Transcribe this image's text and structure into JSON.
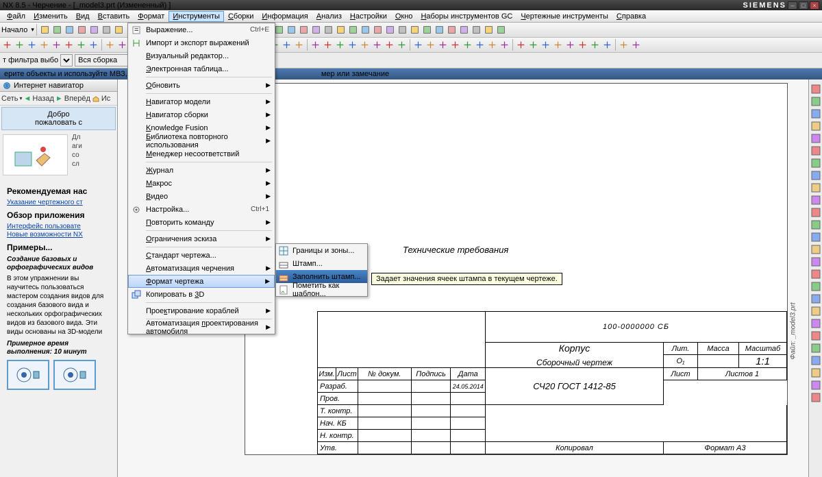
{
  "title": "NX 8.5 - Черчение - [_model3.prt (Измененный) ]",
  "brand": "SIEMENS",
  "menubar": [
    "Файл",
    "Изменить",
    "Вид",
    "Вставить",
    "Формат",
    "Инструменты",
    "Сборки",
    "Информация",
    "Анализ",
    "Настройки",
    "Окно",
    "Наборы инструментов GC",
    "Чертежные инструменты",
    "Справка"
  ],
  "toolbar1_label": "Начало",
  "filter_label": "т фильтра выбо",
  "filter_combo": "Вся сборка",
  "selbar_text": "ерите объекты и используйте МВЗ, или дво",
  "selbar_hint": "мер или замечание",
  "sidebar": {
    "title": "Интернет навигатор",
    "nav": [
      "Сеть",
      "Назад",
      "Вперёд",
      "Ис"
    ],
    "welcome1": "Добро",
    "welcome2": "пожаловать с",
    "side_txt": "Дл\nаги\nсо\nсл",
    "h1": "Рекомендуемая нас",
    "link1": "Указание чертежного ст",
    "h2": "Обзор приложения",
    "link2": "Интерфейс пользовате",
    "link3": "Новые возможности NX",
    "h3": "Примеры...",
    "em1": "Создание базовых и орфографических видов",
    "p1": "В этом упражнении вы научитесь пользоваться мастером создания видов для создания базового вида и нескольких орфографических видов из базового вида. Эти виды основаны на 3D-модели",
    "em2": "Примерное время выполнения: 10 минут"
  },
  "menu": {
    "items": [
      {
        "t": "Выражение...",
        "sc": "Ctrl+E",
        "ico": "expr"
      },
      {
        "t": "Импорт и экспорт выражений",
        "ico": "impexp"
      },
      {
        "t": "Визуальный редактор...",
        "u": "В"
      },
      {
        "t": "Электронная таблица...",
        "u": "Э"
      },
      {
        "sep": 1
      },
      {
        "t": "Обновить",
        "arr": 1,
        "u": "О"
      },
      {
        "sep": 1
      },
      {
        "t": "Навигатор модели",
        "arr": 1,
        "u": "Н"
      },
      {
        "t": "Навигатор сборки",
        "arr": 1,
        "u": "Н"
      },
      {
        "t": "Knowledge Fusion",
        "arr": 1,
        "u": "K"
      },
      {
        "t": "Библиотека повторного использования",
        "arr": 1,
        "u": "Б"
      },
      {
        "t": "Менеджер несоответствий",
        "u": "М"
      },
      {
        "sep": 1
      },
      {
        "t": "Журнал",
        "arr": 1,
        "u": "Ж"
      },
      {
        "t": "Макрос",
        "arr": 1,
        "u": "М"
      },
      {
        "t": "Видео",
        "arr": 1,
        "u": "В"
      },
      {
        "t": "Настройка...",
        "sc": "Ctrl+1",
        "ico": "gear"
      },
      {
        "t": "Повторить команду",
        "arr": 1,
        "u": "П"
      },
      {
        "sep": 1
      },
      {
        "t": "Ограничения эскиза",
        "arr": 1,
        "u": "О"
      },
      {
        "sep": 1
      },
      {
        "t": "Стандарт чертежа...",
        "u": "С"
      },
      {
        "t": "Автоматизация черчения",
        "arr": 1,
        "u": "А"
      },
      {
        "t": "Формат чертежа",
        "arr": 1,
        "hl": 1,
        "u": "Ф"
      },
      {
        "t": "Копировать в 3D",
        "ico": "copy3d",
        "u": "3"
      },
      {
        "sep": 1
      },
      {
        "t": "Проектирование кораблей",
        "arr": 1,
        "u": "к"
      },
      {
        "sep": 1
      },
      {
        "t": "Автоматизация проектирования автомобиля",
        "arr": 1,
        "u": "п"
      }
    ]
  },
  "submenu": {
    "items": [
      {
        "t": "Границы и зоны...",
        "ico": "bz"
      },
      {
        "t": "Штамп...",
        "ico": "st"
      },
      {
        "t": "Заполнить штамп...",
        "ico": "fill",
        "hl": 1
      },
      {
        "sep": 1
      },
      {
        "t": "Пометить как шаблон...",
        "ico": "tmpl"
      }
    ]
  },
  "tooltip": "Задает значения ячеек штампа в текущем чертеже.",
  "drawing": {
    "techreq": "Технические требования",
    "partnum": "100-0000000  СБ",
    "hdr": [
      "Изм.",
      "Лист",
      "№ докум.",
      "Подпись",
      "Дата"
    ],
    "rows": [
      "Разраб.",
      "Пров.",
      "Т. контр.",
      "Нач. КБ",
      "Н. контр.",
      "Утв."
    ],
    "date": "24.05.2014",
    "name1": "Корпус",
    "name2": "Сборочный чертеж",
    "material": "СЧ20 ГОСТ 1412-85",
    "lit": "Лит.",
    "litval": "О₁",
    "mass": "Масса",
    "scale": "Масштаб",
    "scaleval": "1:1",
    "sheet": "Лист",
    "sheets": "Листов 1",
    "copied": "Копировал",
    "format": "Формат А3",
    "file": "Файл: _model3.prt"
  }
}
